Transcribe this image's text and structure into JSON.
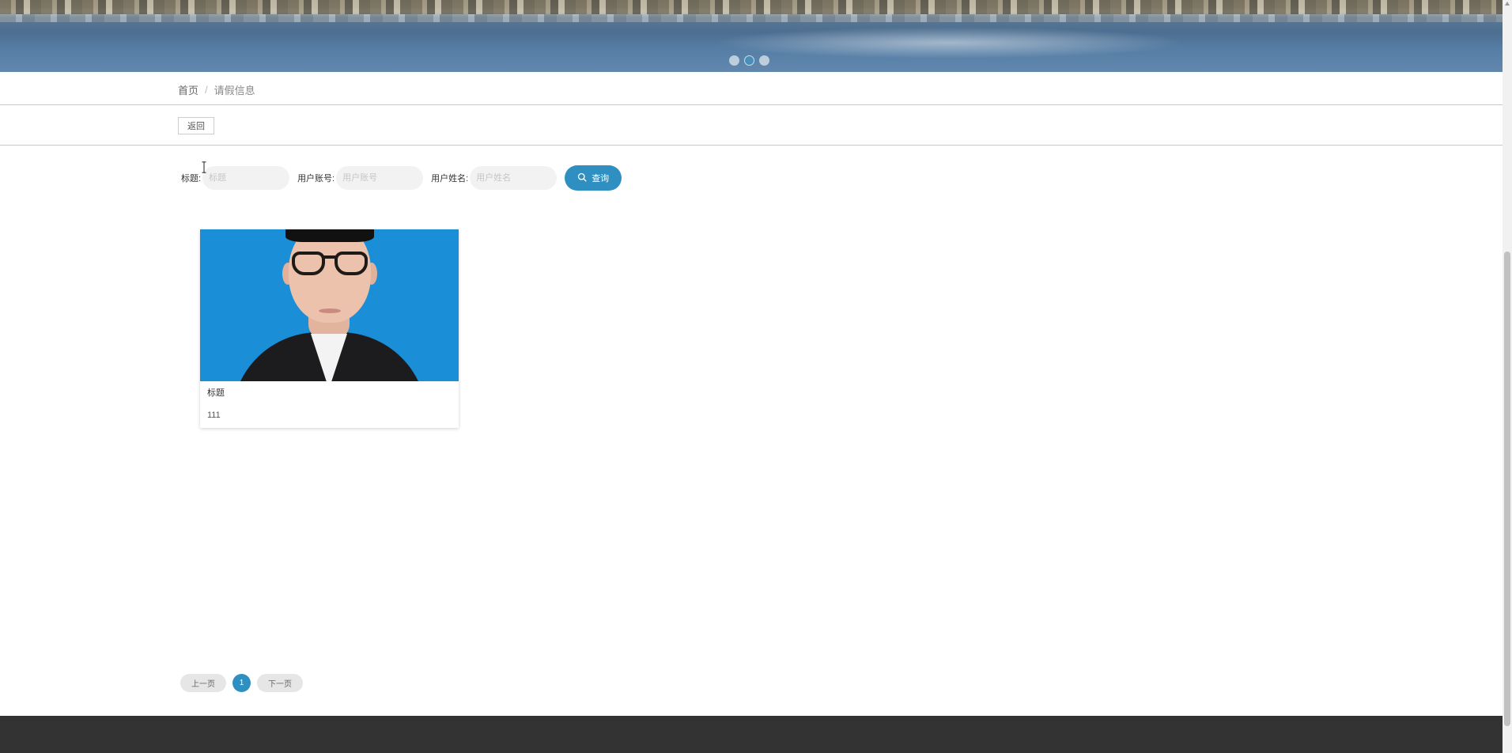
{
  "banner": {
    "slide_count": 3,
    "active_slide": 2
  },
  "breadcrumb": {
    "home": "首页",
    "separator": "/",
    "current": "请假信息"
  },
  "actions": {
    "back_label": "返回"
  },
  "search": {
    "fields": [
      {
        "label": "标题:",
        "placeholder": "标题",
        "value": ""
      },
      {
        "label": "用户账号:",
        "placeholder": "用户账号",
        "value": ""
      },
      {
        "label": "用户姓名:",
        "placeholder": "用户姓名",
        "value": ""
      }
    ],
    "button_label": "查询",
    "button_icon": "search-icon"
  },
  "cards": [
    {
      "image": "portrait-photo",
      "title": "标题",
      "content": "111"
    }
  ],
  "pagination": {
    "prev_label": "上一页",
    "current_page": "1",
    "next_label": "下一页"
  },
  "colors": {
    "accent": "#2e8fc0",
    "footer": "#333333",
    "photo_background": "#1a8ed6"
  }
}
